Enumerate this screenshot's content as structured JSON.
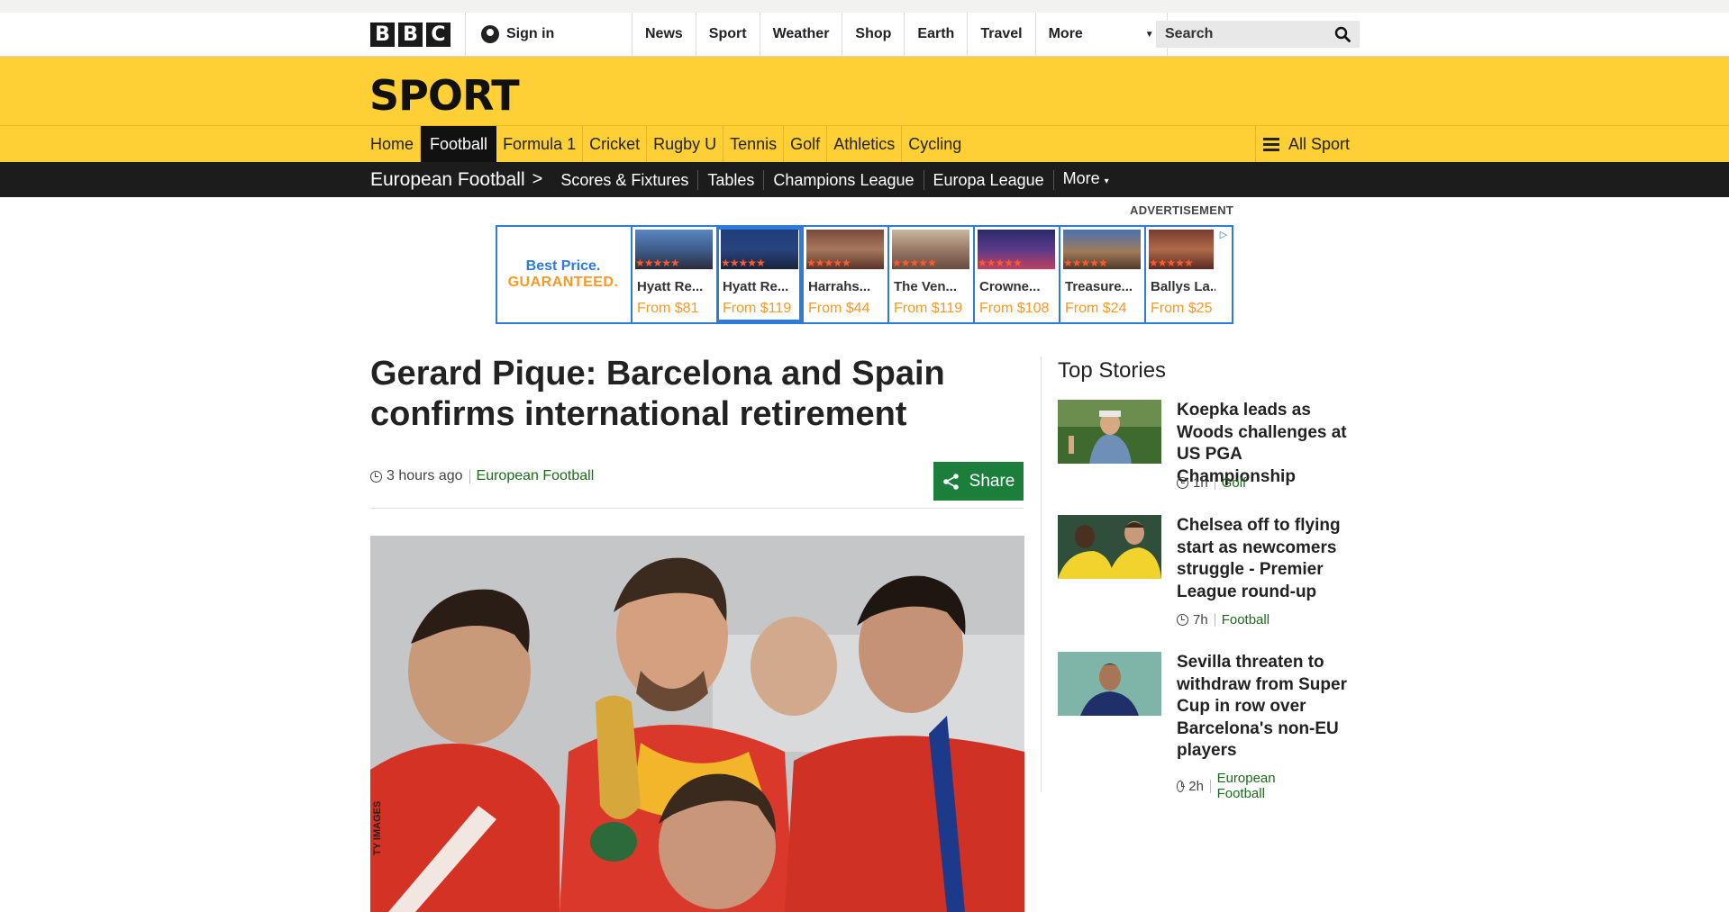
{
  "global_nav": {
    "logo_letters": [
      "B",
      "B",
      "C"
    ],
    "signin": "Sign in",
    "links": [
      "News",
      "Sport",
      "Weather",
      "Shop",
      "Earth",
      "Travel"
    ],
    "more": "More",
    "search_placeholder": "Search"
  },
  "sport": {
    "title": "SPORT",
    "nav": [
      "Home",
      "Football",
      "Formula 1",
      "Cricket",
      "Rugby U",
      "Tennis",
      "Golf",
      "Athletics",
      "Cycling"
    ],
    "active": "Football",
    "all_sport": "All Sport"
  },
  "subnav": {
    "section": "European Football",
    "chevron": ">",
    "links": [
      "Scores & Fixtures",
      "Tables",
      "Champions League",
      "Europa League"
    ],
    "more": "More"
  },
  "ad": {
    "label": "ADVERTISEMENT",
    "brand_line1": "Best Price.",
    "brand_line2": "GUARANTEED.",
    "cards": [
      {
        "name": "Hyatt Re...",
        "price": "From $81"
      },
      {
        "name": "Hyatt Re...",
        "price": "From $119"
      },
      {
        "name": "Harrahs...",
        "price": "From $44"
      },
      {
        "name": "The Ven...",
        "price": "From $119"
      },
      {
        "name": "Crowne...",
        "price": "From $108"
      },
      {
        "name": "Treasure...",
        "price": "From $24"
      },
      {
        "name": "Ballys La...",
        "price": "From $25"
      }
    ]
  },
  "article": {
    "headline": "Gerard Pique: Barcelona and Spain confirms international retirement",
    "time": "3 hours ago",
    "section": "European Football",
    "share": "Share",
    "photo_credit": "TY IMAGES"
  },
  "top_stories": {
    "title": "Top Stories",
    "items": [
      {
        "title": "Koepka leads as Woods challenges at US PGA Championship",
        "time": "1h",
        "section": "Golf"
      },
      {
        "title": "Chelsea off to flying start as newcomers struggle - Premier League round-up",
        "time": "7h",
        "section": "Football"
      },
      {
        "title": "Sevilla threaten to withdraw from Super Cup in row over Barcelona's non-EU players",
        "time": "2h",
        "section": "European Football"
      }
    ]
  },
  "colors": {
    "sport_yellow": "#fed035",
    "share_green": "#1b7f3b",
    "section_green": "#1a6b1a",
    "ad_blue": "#2f7bd9",
    "ad_orange": "#f59a23"
  }
}
